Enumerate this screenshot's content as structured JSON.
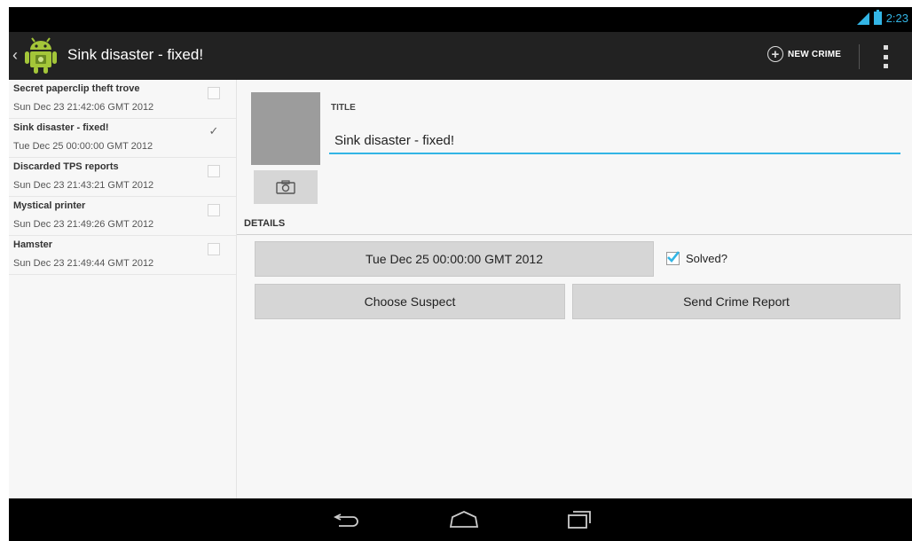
{
  "status_bar": {
    "signal_badge": "3G",
    "time": "2:23"
  },
  "action_bar": {
    "title": "Sink disaster - fixed!",
    "new_crime_label": "NEW CRIME"
  },
  "crime_list": [
    {
      "title": "Secret paperclip theft trove",
      "date": "Sun Dec 23 21:42:06 GMT 2012",
      "solved": false
    },
    {
      "title": "Sink disaster - fixed!",
      "date": "Tue Dec 25 00:00:00 GMT 2012",
      "solved": true
    },
    {
      "title": "Discarded TPS reports",
      "date": "Sun Dec 23 21:43:21 GMT 2012",
      "solved": false
    },
    {
      "title": "Mystical printer",
      "date": "Sun Dec 23 21:49:26 GMT 2012",
      "solved": false
    },
    {
      "title": "Hamster",
      "date": "Sun Dec 23 21:49:44 GMT 2012",
      "solved": false
    }
  ],
  "detail": {
    "title_label": "TITLE",
    "title_value": "Sink disaster - fixed!",
    "details_label": "DETAILS",
    "date_button": "Tue Dec 25 00:00:00 GMT 2012",
    "solved_label": "Solved?",
    "solved_checked": true,
    "choose_suspect": "Choose Suspect",
    "send_report": "Send Crime Report"
  },
  "colors": {
    "accent": "#33b5e5",
    "action_bar": "#222222",
    "background": "#f7f7f7"
  }
}
